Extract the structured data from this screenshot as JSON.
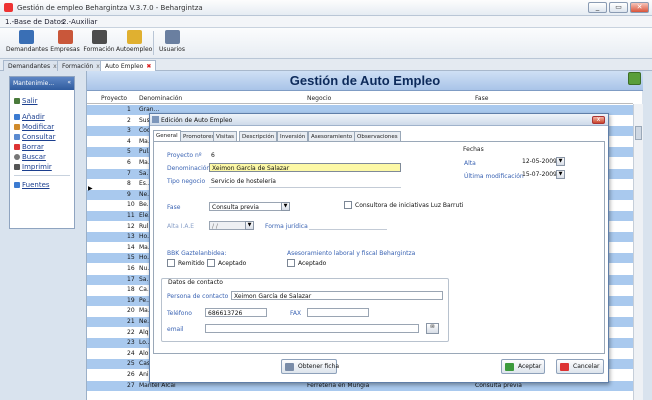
{
  "window": {
    "title": "Gestión de empleo Behargintza V.3.7.0 - Behargintza",
    "minimize": "_",
    "maximize": "▭",
    "close": "✕"
  },
  "menu": [
    "1.-Base de Datos",
    "2.-Auxiliar"
  ],
  "toolbar": [
    "Demandantes",
    "Empresas",
    "Formación",
    "Autoempleo",
    "Usuarios"
  ],
  "doc_tabs": [
    {
      "label": "Demandantes",
      "close": "x"
    },
    {
      "label": "Formación",
      "close": "x"
    },
    {
      "label": "Auto Empleo",
      "close": "✖"
    }
  ],
  "left_panel": {
    "title": "Mantenimie...",
    "collapse": "«",
    "items": [
      "Salir",
      "Añadir",
      "Modificar",
      "Consultar",
      "Borrar",
      "Buscar",
      "Imprimir",
      "Fuentes"
    ]
  },
  "grid": {
    "title": "Gestión de Auto Empleo",
    "columns": [
      "Proyecto",
      "Denominación",
      "Negocio",
      "Fase"
    ],
    "rows": [
      {
        "id": "1",
        "name": "Gran..."
      },
      {
        "id": "2",
        "name": "Sus..."
      },
      {
        "id": "3",
        "name": "Coc..."
      },
      {
        "id": "4",
        "name": "Ma..."
      },
      {
        "id": "5",
        "name": "Pul..."
      },
      {
        "id": "6",
        "name": "Ma..."
      },
      {
        "id": "7",
        "name": "Sa..."
      },
      {
        "id": "8",
        "name": "Es..."
      },
      {
        "id": "9",
        "name": "Ne..."
      },
      {
        "id": "10",
        "name": "Be..."
      },
      {
        "id": "11",
        "name": "Ele..."
      },
      {
        "id": "12",
        "name": "Rul..."
      },
      {
        "id": "13",
        "name": "Ho..."
      },
      {
        "id": "14",
        "name": "Ma..."
      },
      {
        "id": "15",
        "name": "Ho..."
      },
      {
        "id": "16",
        "name": "Nu..."
      },
      {
        "id": "17",
        "name": "Sa..."
      },
      {
        "id": "18",
        "name": "Ca..."
      },
      {
        "id": "19",
        "name": "Pe..."
      },
      {
        "id": "20",
        "name": "Ma..."
      },
      {
        "id": "21",
        "name": "Ne..."
      },
      {
        "id": "22",
        "name": "Alq..."
      },
      {
        "id": "23",
        "name": "Lo..."
      },
      {
        "id": "24",
        "name": "Alo..."
      },
      {
        "id": "25",
        "name": "Cas..."
      },
      {
        "id": "26",
        "name": "Ani...",
        "business": "...",
        "phase": "Consulta previa"
      },
      {
        "id": "27",
        "name": "Mantel Alcai",
        "business": "Ferretería en Mungia",
        "phase": "Consulta previa"
      }
    ]
  },
  "dialog": {
    "title": "Edición de Auto Empleo",
    "close": "x",
    "tabs": [
      "General",
      "Promotores",
      "Visitas",
      "Descripción",
      "Inversión",
      "Asesoramiento",
      "Observaciones"
    ],
    "labels": {
      "proyecto": "Proyecto nº",
      "denominacion": "Denominación",
      "tipo_negocio": "Tipo negocio",
      "fase": "Fase",
      "alta_iae": "Alta I.A.E",
      "forma_juridica": "Forma jurídica",
      "fechas": "Fechas",
      "alta": "Alta",
      "ultima_mod": "Última modificación",
      "iniciativas": "Consultora de iniciativas Luz Barruti",
      "bbk_title": "BBK Gaztelanbidea:",
      "remitido": "Remitido",
      "aceptado": "Aceptado",
      "asesor_title": "Asesoramiento laboral y fiscal Behargintza",
      "aceptado2": "Aceptado",
      "contacto_title": "Datos de contacto",
      "persona": "Persona de contacto",
      "telefono": "Teléfono",
      "fax": "FAX",
      "email": "email"
    },
    "values": {
      "proyecto": "6",
      "denominacion": "Xeimon García de Salazar",
      "tipo_negocio": "Servicio de hostelería",
      "fase": "Consulta previa",
      "alta_iae": "/ /",
      "fecha_alta": "12-05-2009",
      "ultima_mod": "15-07-2009",
      "persona": "Xeimon García de Salazar",
      "telefono": "686613726"
    },
    "buttons": {
      "obtener": "Obtener ficha",
      "aceptar": "Aceptar",
      "cancelar": "Cancelar"
    }
  }
}
